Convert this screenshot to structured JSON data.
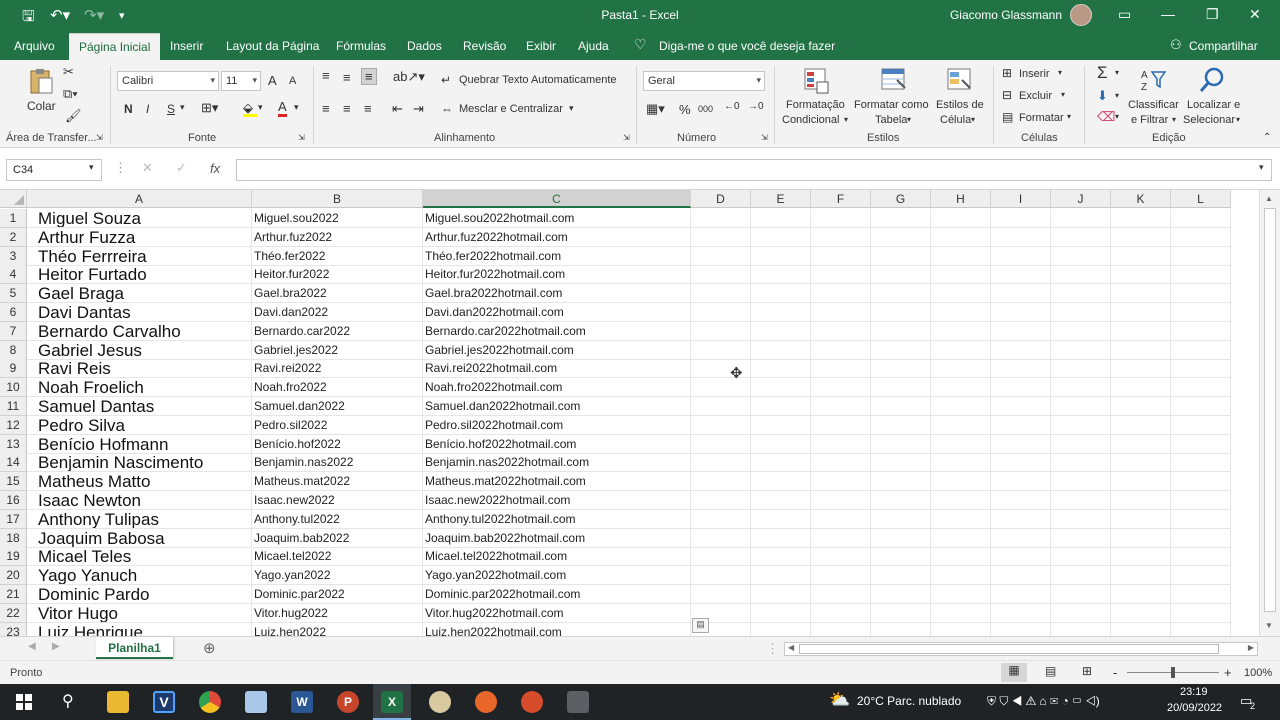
{
  "window": {
    "title": "Pasta1  -  Excel",
    "user": "Giacomo Glassmann"
  },
  "tabs": [
    "Arquivo",
    "Página Inicial",
    "Inserir",
    "Layout da Página",
    "Fórmulas",
    "Dados",
    "Revisão",
    "Exibir",
    "Ajuda"
  ],
  "tell_me": "Diga-me o que você deseja fazer",
  "share": "Compartilhar",
  "ribbon": {
    "clipboard": {
      "paste": "Colar",
      "label": "Área de Transfer..."
    },
    "font": {
      "name": "Calibri",
      "size": "11",
      "bold": "N",
      "italic": "I",
      "underline": "S",
      "grow": "A",
      "shrink": "A",
      "color_letter": "A",
      "label": "Fonte"
    },
    "alignment": {
      "wrap": "Quebrar Texto Automaticamente",
      "merge": "Mesclar e Centralizar",
      "label": "Alinhamento"
    },
    "number": {
      "format": "Geral",
      "percent": "%",
      "thousands": "000",
      "label": "Número"
    },
    "styles": {
      "conditional_1": "Formatação",
      "conditional_2": "Condicional",
      "table_1": "Formatar como",
      "table_2": "Tabela",
      "cell_1": "Estilos de",
      "cell_2": "Célula",
      "label": "Estilos"
    },
    "cells": {
      "insert": "Inserir",
      "delete": "Excluir",
      "format": "Formatar",
      "label": "Células"
    },
    "editing": {
      "sort_1": "Classificar",
      "sort_2": "e Filtrar",
      "find_1": "Localizar e",
      "find_2": "Selecionar",
      "label": "Edição"
    }
  },
  "formula_bar": {
    "name_box": "C34",
    "fx": "fx",
    "value": ""
  },
  "columns": [
    "A",
    "B",
    "C",
    "D",
    "E",
    "F",
    "G",
    "H",
    "I",
    "J",
    "K",
    "L"
  ],
  "selected_column": "C",
  "rows": [
    [
      "Miguel Souza",
      "Miguel.sou2022",
      "Miguel.sou2022hotmail.com"
    ],
    [
      "Arthur Fuzza",
      "Arthur.fuz2022",
      "Arthur.fuz2022hotmail.com"
    ],
    [
      "Théo Ferrreira",
      "Théo.fer2022",
      "Théo.fer2022hotmail.com"
    ],
    [
      "Heitor Furtado",
      "Heitor.fur2022",
      "Heitor.fur2022hotmail.com"
    ],
    [
      "Gael Braga",
      "Gael.bra2022",
      "Gael.bra2022hotmail.com"
    ],
    [
      "Davi Dantas",
      "Davi.dan2022",
      "Davi.dan2022hotmail.com"
    ],
    [
      "Bernardo Carvalho",
      "Bernardo.car2022",
      "Bernardo.car2022hotmail.com"
    ],
    [
      "Gabriel Jesus",
      "Gabriel.jes2022",
      "Gabriel.jes2022hotmail.com"
    ],
    [
      "Ravi Reis",
      "Ravi.rei2022",
      "Ravi.rei2022hotmail.com"
    ],
    [
      "Noah Froelich",
      "Noah.fro2022",
      "Noah.fro2022hotmail.com"
    ],
    [
      "Samuel Dantas",
      "Samuel.dan2022",
      "Samuel.dan2022hotmail.com"
    ],
    [
      "Pedro Silva",
      "Pedro.sil2022",
      "Pedro.sil2022hotmail.com"
    ],
    [
      "Benício Hofmann",
      "Benício.hof2022",
      "Benício.hof2022hotmail.com"
    ],
    [
      "Benjamin Nascimento",
      "Benjamin.nas2022",
      "Benjamin.nas2022hotmail.com"
    ],
    [
      "Matheus Matto",
      "Matheus.mat2022",
      "Matheus.mat2022hotmail.com"
    ],
    [
      "Isaac Newton",
      "Isaac.new2022",
      "Isaac.new2022hotmail.com"
    ],
    [
      "Anthony Tulipas",
      "Anthony.tul2022",
      "Anthony.tul2022hotmail.com"
    ],
    [
      "Joaquim Babosa",
      "Joaquim.bab2022",
      "Joaquim.bab2022hotmail.com"
    ],
    [
      "Micael Teles",
      "Micael.tel2022",
      "Micael.tel2022hotmail.com"
    ],
    [
      "Yago Yanuch",
      "Yago.yan2022",
      "Yago.yan2022hotmail.com"
    ],
    [
      "Dominic Pardo",
      "Dominic.par2022",
      "Dominic.par2022hotmail.com"
    ],
    [
      "Vitor Hugo",
      "Vitor.hug2022",
      "Vitor.hug2022hotmail.com"
    ],
    [
      "Luiz Henrique",
      "Luiz.hen2022",
      "Luiz.hen2022hotmail.com"
    ]
  ],
  "sheet_tab": "Planilha1",
  "status": {
    "ready": "Pronto",
    "zoom": "100%",
    "zoom_minus": "-",
    "zoom_plus": "+"
  },
  "taskbar": {
    "weather": "20°C  Parc. nublado",
    "time": "23:19",
    "date": "20/09/2022",
    "notifications": "2"
  },
  "colors": {
    "excel_green": "#217346",
    "ribbon_bg": "#f3f3f3",
    "taskbar": "#1f2326"
  }
}
